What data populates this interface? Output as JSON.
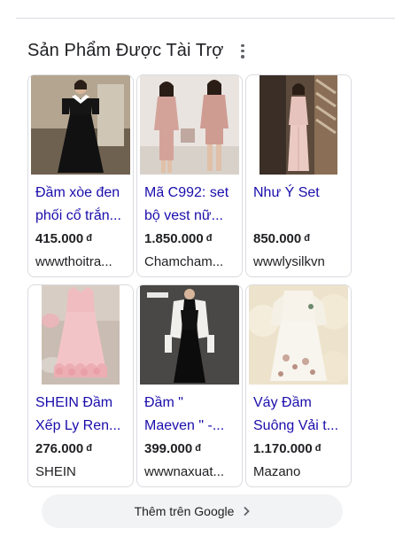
{
  "section": {
    "title": "Sản Phẩm Được Tài Trợ",
    "menu_icon": "more-vert-icon"
  },
  "products": [
    {
      "title": "Đầm xòe đen phối cổ trắn...",
      "price": "415.000",
      "currency": "đ",
      "seller": "wwwthoitra...",
      "image": "black-dress-white-collar"
    },
    {
      "title": "Mã C992: set bộ vest nữ...",
      "price": "1.850.000",
      "currency": "đ",
      "seller": "Chamcham...",
      "image": "pink-suit-set"
    },
    {
      "title": "Như Ý Set",
      "price": "850.000",
      "currency": "đ",
      "seller": "wwwlysilkvn",
      "image": "pink-long-set"
    },
    {
      "title": "SHEIN Đầm Xếp Ly Ren...",
      "price": "276.000",
      "currency": "đ",
      "seller": "SHEIN",
      "image": "pink-ruffle-dress"
    },
    {
      "title": "Đầm \" Maeven \" -...",
      "price": "399.000",
      "currency": "đ",
      "seller": "wwwnaxuat...",
      "image": "black-long-dress"
    },
    {
      "title": "Váy Đầm Suông Vải t...",
      "price": "1.170.000",
      "currency": "đ",
      "seller": "Mazano",
      "image": "cream-floral-dress"
    }
  ],
  "footer": {
    "more_label": "Thêm trên Google",
    "more_icon": "chevron-right-icon"
  }
}
